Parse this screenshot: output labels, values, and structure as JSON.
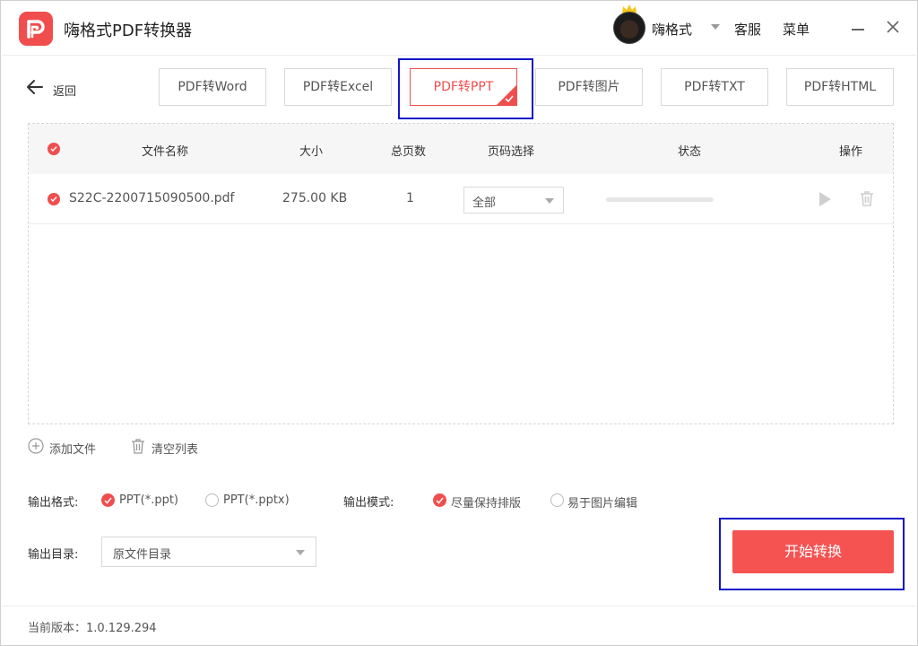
{
  "app": {
    "title": "嗨格式PDF转换器"
  },
  "header": {
    "username": "嗨格式",
    "service": "客服",
    "menu": "菜单"
  },
  "nav": {
    "back_label": "返回"
  },
  "tabs": [
    {
      "label": "PDF转Word",
      "active": false
    },
    {
      "label": "PDF转Excel",
      "active": false
    },
    {
      "label": "PDF转PPT",
      "active": true
    },
    {
      "label": "PDF转图片",
      "active": false
    },
    {
      "label": "PDF转TXT",
      "active": false
    },
    {
      "label": "PDF转HTML",
      "active": false
    }
  ],
  "table": {
    "columns": [
      "文件名称",
      "大小",
      "总页数",
      "页码选择",
      "状态",
      "操作"
    ],
    "rows": [
      {
        "name": "S22C-2200715090500.pdf",
        "size": "275.00 KB",
        "pages": "1",
        "page_select": "全部",
        "progress": 0
      }
    ]
  },
  "actions": {
    "add_file": "添加文件",
    "clear_list": "清空列表"
  },
  "output": {
    "format_label": "输出格式:",
    "format_options": [
      "PPT(*.ppt)",
      "PPT(*.pptx)"
    ],
    "format_selected": "PPT(*.ppt)",
    "mode_label": "输出模式:",
    "mode_options": [
      "尽量保持排版",
      "易于图片编辑"
    ],
    "mode_selected": "尽量保持排版",
    "dir_label": "输出目录:",
    "dir_value": "原文件目录"
  },
  "start_button": "开始转换",
  "footer": {
    "version": "当前版本：1.0.129.294"
  },
  "colors": {
    "accent": "#f04e4e",
    "highlight_box": "#1414c8"
  }
}
